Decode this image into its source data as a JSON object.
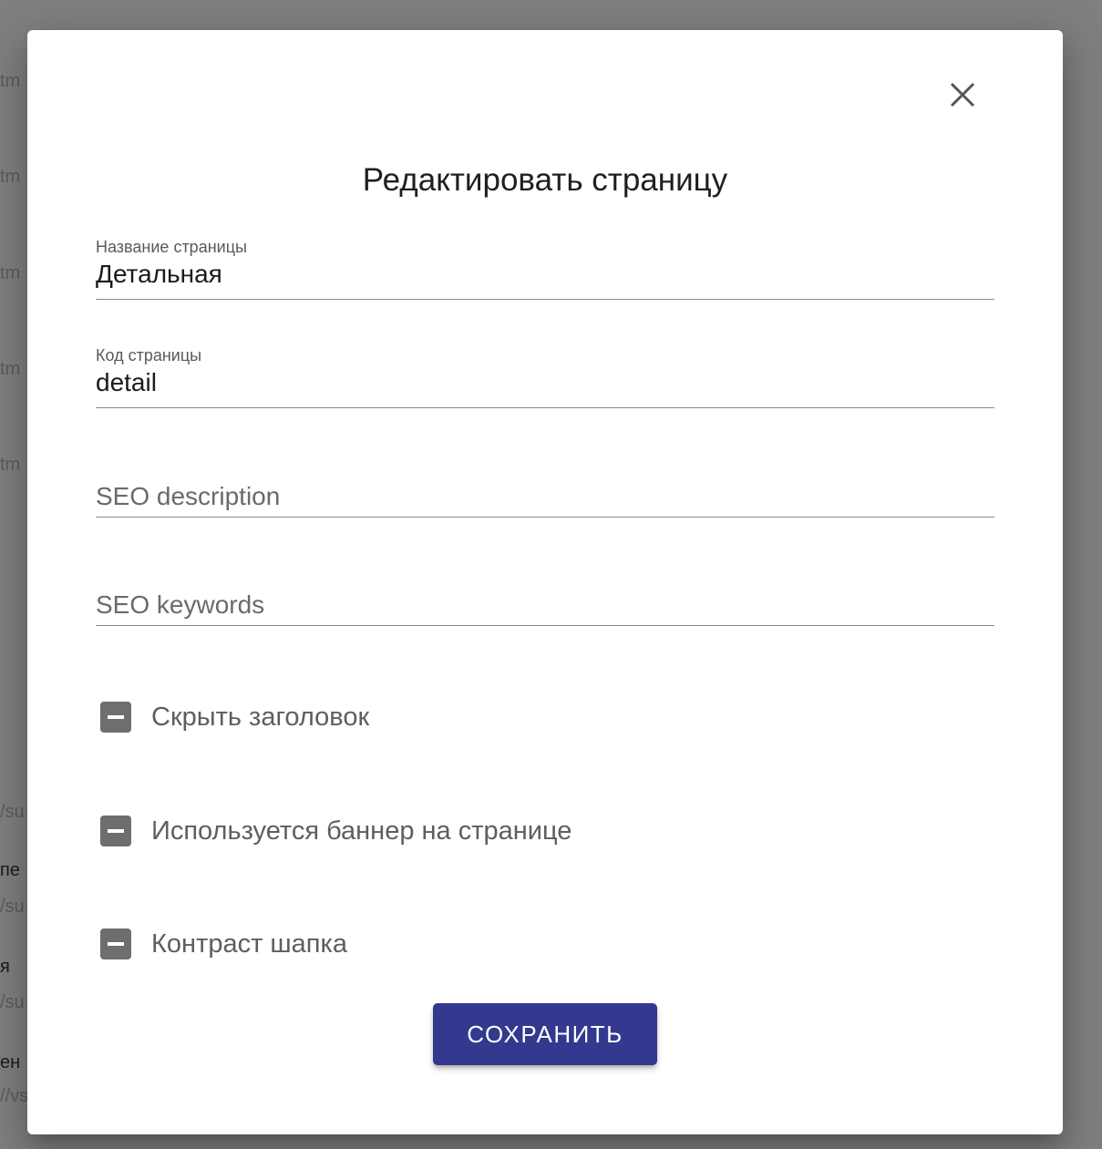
{
  "background": {
    "fragments": [
      {
        "text": "tm",
        "style": "muted"
      },
      {
        "text": "tm",
        "style": "muted"
      },
      {
        "text": "tm",
        "style": "muted"
      },
      {
        "text": "tm",
        "style": "muted"
      },
      {
        "text": "tm",
        "style": "muted"
      },
      {
        "text": "/su",
        "style": "muted"
      },
      {
        "text": "пе",
        "style": "dark"
      },
      {
        "text": "/su",
        "style": "muted"
      },
      {
        "text": "я",
        "style": "dark"
      },
      {
        "text": "/su",
        "style": "muted"
      },
      {
        "text": "ен",
        "style": "dark"
      },
      {
        "text": "//vs",
        "style": "muted"
      }
    ]
  },
  "dialog": {
    "close_icon": "close-icon",
    "title": "Редактировать страницу",
    "fields": {
      "page_name": {
        "label": "Название страницы",
        "value": "Детальная"
      },
      "page_code": {
        "label": "Код страницы",
        "value": "detail"
      },
      "seo_description": {
        "placeholder": "SEO description",
        "value": ""
      },
      "seo_keywords": {
        "placeholder": "SEO keywords",
        "value": ""
      }
    },
    "checkboxes": [
      {
        "label": "Скрыть заголовок",
        "state": "indeterminate"
      },
      {
        "label": "Используется баннер на странице",
        "state": "indeterminate"
      },
      {
        "label": "Контраст шапка",
        "state": "indeterminate"
      }
    ],
    "save_label": "СОХРАНИТЬ"
  },
  "colors": {
    "overlay": "#8a8a8a",
    "primary_button": "#33398e",
    "checkbox": "#6e6e6e"
  }
}
